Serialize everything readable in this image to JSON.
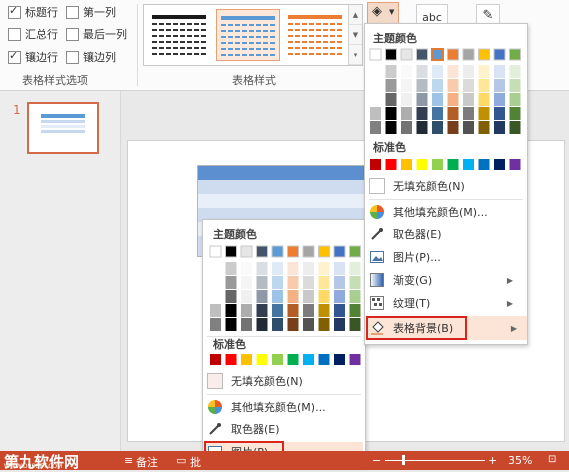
{
  "ribbon": {
    "options": {
      "header_row": "标题行",
      "first_column": "第一列",
      "total_row": "汇总行",
      "last_column": "最后一列",
      "banded_rows": "镶边行",
      "banded_columns": "镶边列",
      "group_label": "表格样式选项"
    },
    "styles_group_label": "表格样式",
    "wordart_label": "abc"
  },
  "slide_number": "1",
  "right_menu": {
    "theme_colors_title": "主题颜色",
    "standard_colors_title": "标准色",
    "no_fill": "无填充颜色(N)",
    "more_colors": "其他填充颜色(M)...",
    "eyedropper": "取色器(E)",
    "picture": "图片(P)...",
    "gradient": "渐变(G)",
    "texture": "纹理(T)",
    "table_background": "表格背景(B)"
  },
  "left_menu": {
    "theme_colors_title": "主题颜色",
    "standard_colors_title": "标准色",
    "no_fill": "无填充颜色(N)",
    "more_colors": "其他填充颜色(M)...",
    "eyedropper": "取色器(E)",
    "picture": "图片(P)..."
  },
  "theme_colors": [
    "#ffffff",
    "#000000",
    "#e7e6e6",
    "#44546a",
    "#5b9bd5",
    "#ed7d31",
    "#a5a5a5",
    "#ffc000",
    "#4472c4",
    "#70ad47"
  ],
  "standard_colors": [
    "#c00000",
    "#ff0000",
    "#ffc000",
    "#ffff00",
    "#92d050",
    "#00b050",
    "#00b0f0",
    "#0070c0",
    "#002060",
    "#7030a0"
  ],
  "status": {
    "notes": "备注",
    "comments": "批",
    "zoom": "35%",
    "watermark_main": "第九软件网",
    "watermark_sub": "WWW.D9SOFT.COM"
  }
}
